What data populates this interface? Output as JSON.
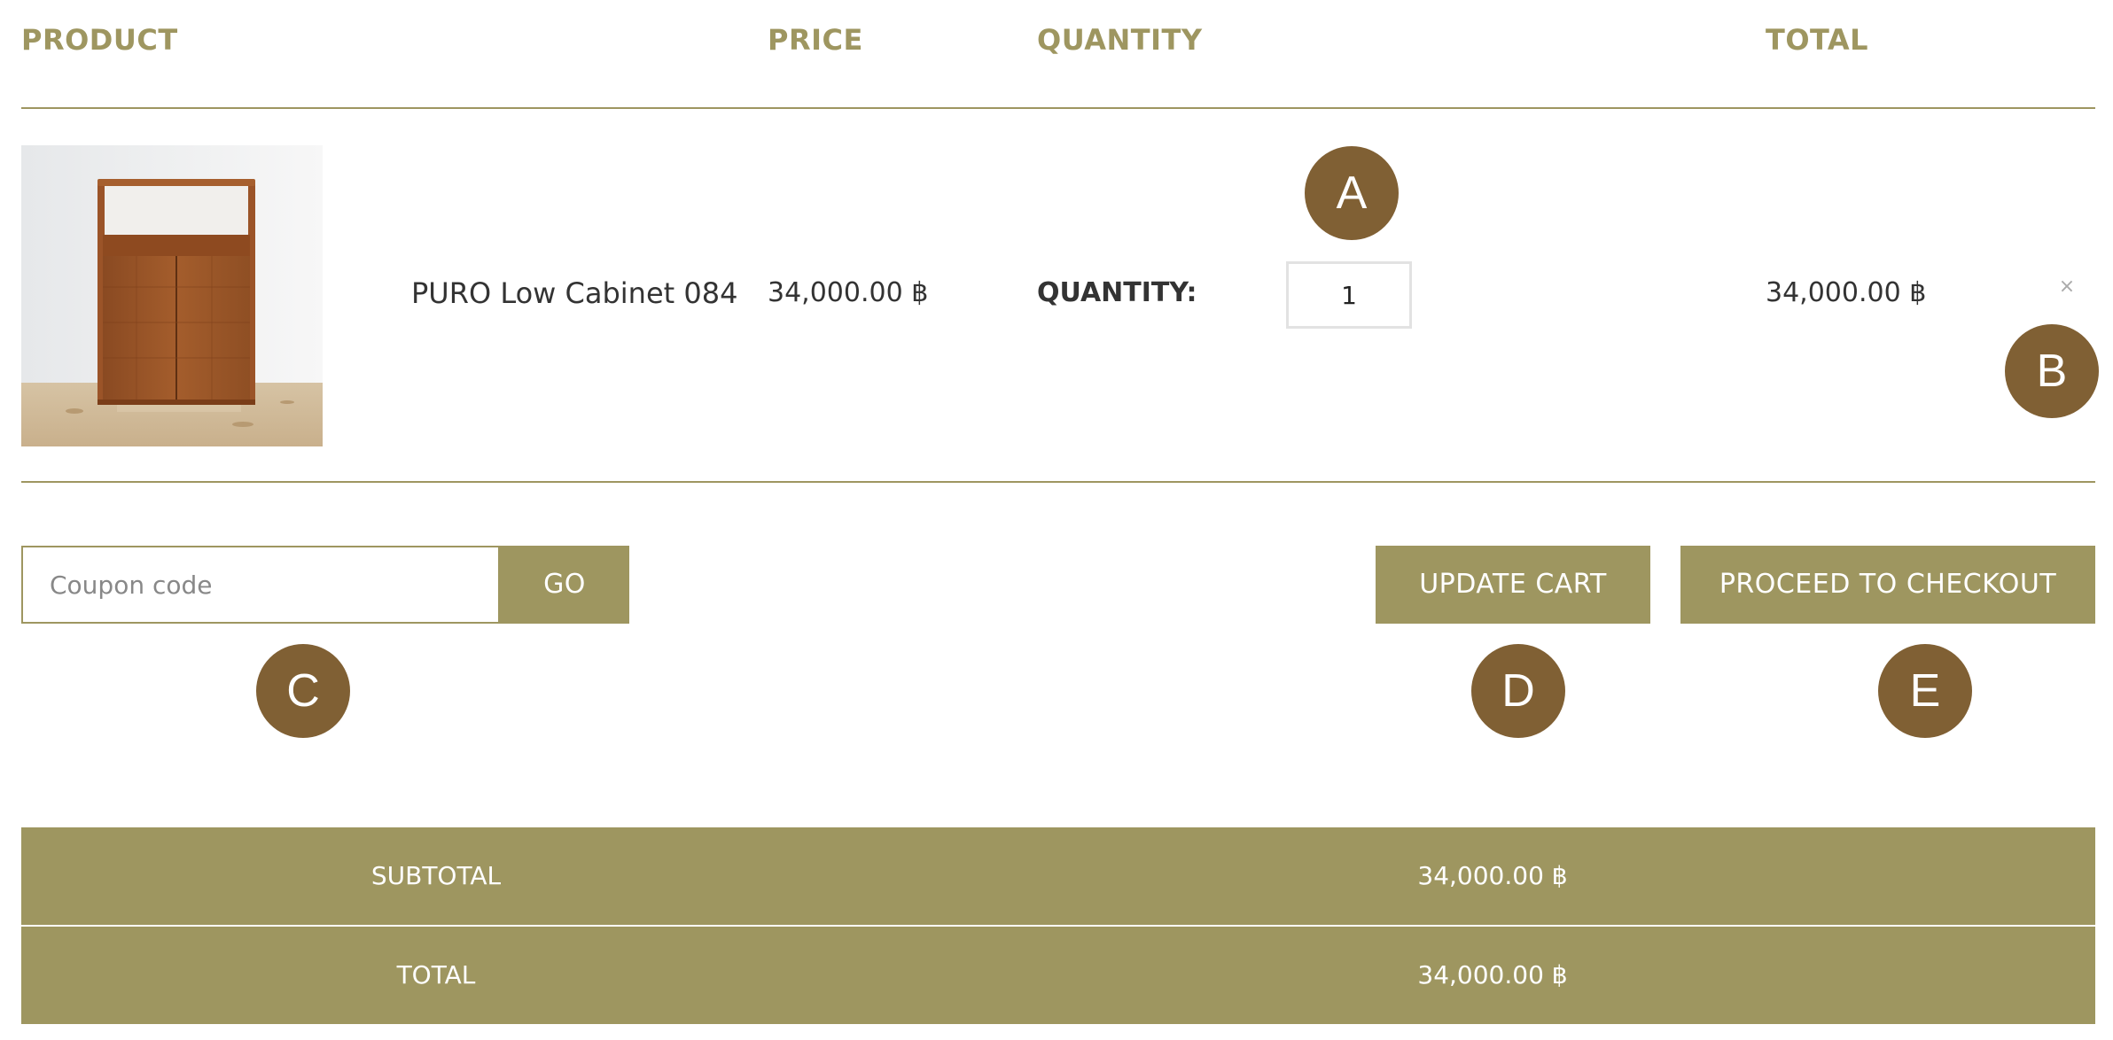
{
  "table_header": {
    "product": "PRODUCT",
    "price": "PRICE",
    "quantity": "QUANTITY",
    "total": "TOTAL"
  },
  "cart_item": {
    "name": "PURO Low Cabinet 084",
    "price": "34,000.00 ฿",
    "quantity_label": "QUANTITY:",
    "quantity": "1",
    "total": "34,000.00 ฿",
    "remove_icon": "×",
    "image_icon": "product-thumbnail-cabinet"
  },
  "coupon": {
    "placeholder": "Coupon code",
    "apply_label": "GO"
  },
  "actions": {
    "update_label": "UPDATE CART",
    "checkout_label": "PROCEED TO CHECKOUT"
  },
  "totals": {
    "subtotal_label": "SUBTOTAL",
    "subtotal_value": "34,000.00 ฿",
    "total_label": "TOTAL",
    "total_value": "34,000.00 ฿"
  },
  "markers": {
    "a": "A",
    "b": "B",
    "c": "C",
    "d": "D",
    "e": "E"
  },
  "colors": {
    "accent": "#9e9660",
    "marker": "#806034"
  }
}
